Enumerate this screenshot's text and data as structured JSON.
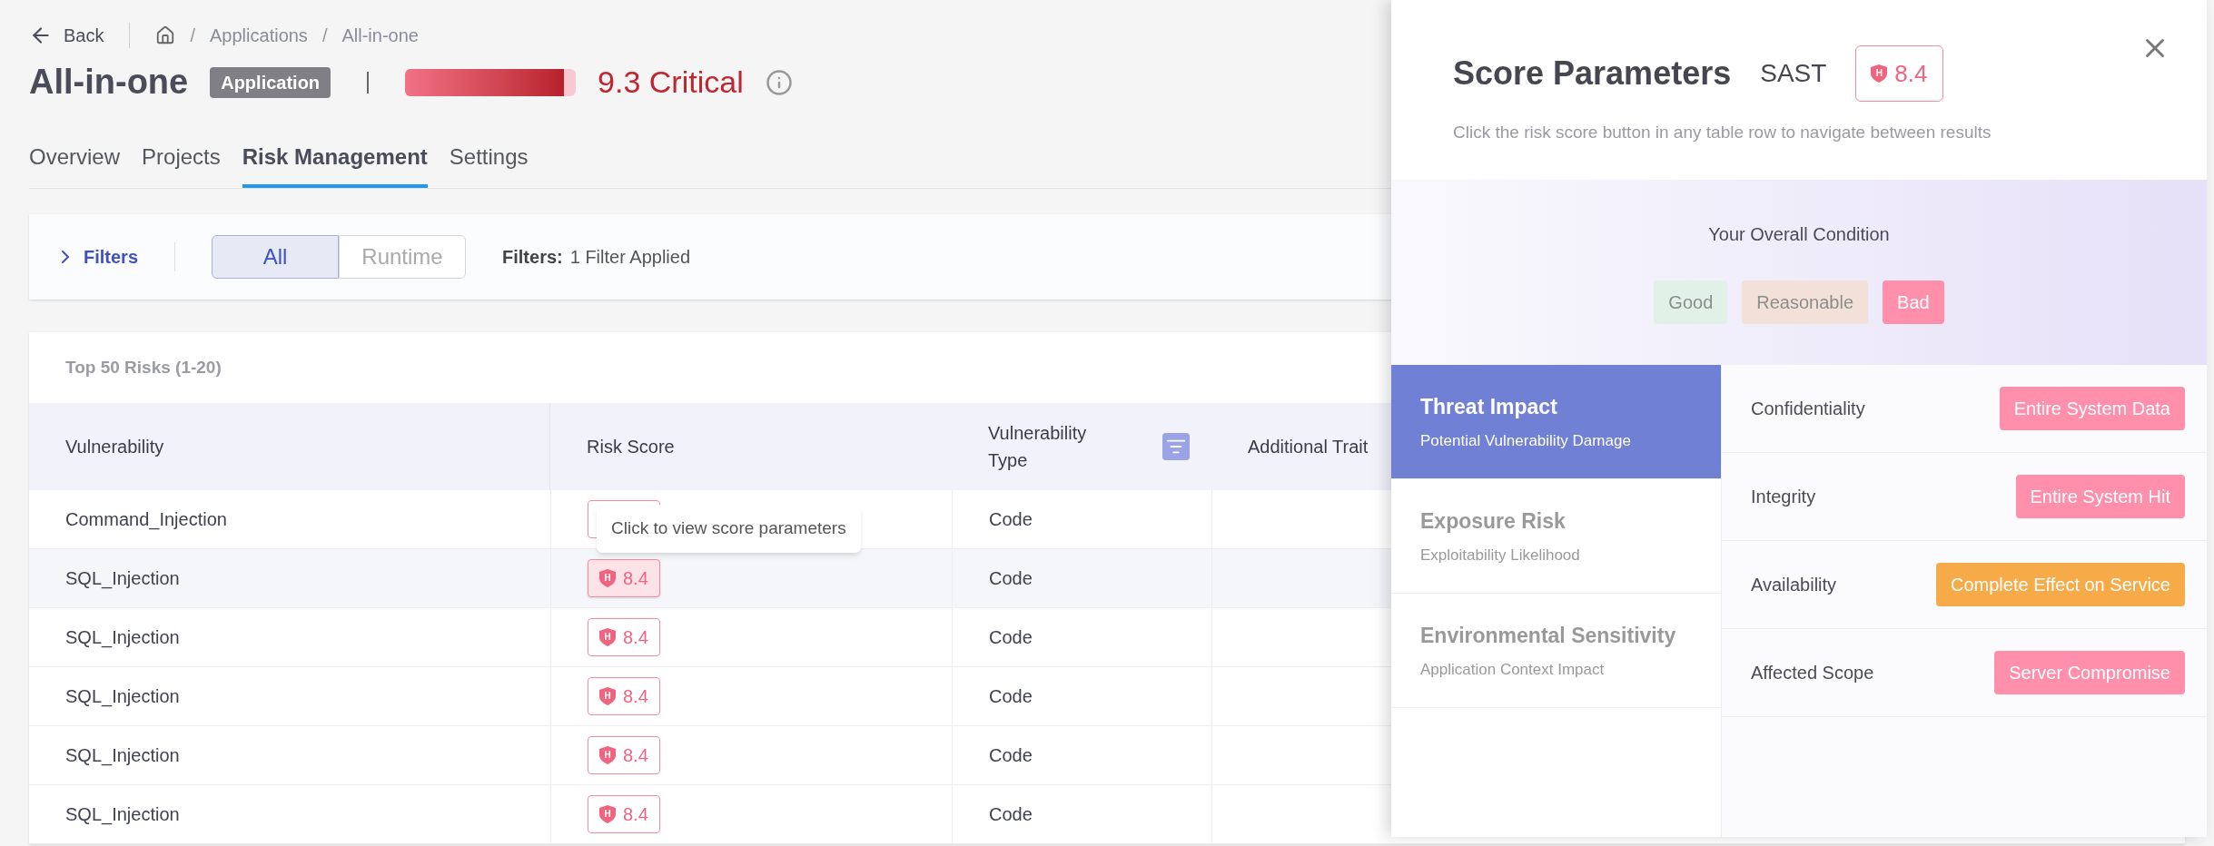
{
  "header": {
    "back": "Back",
    "breadcrumbs": [
      "Applications",
      "All-in-one"
    ],
    "separator": "/",
    "title": "All-in-one",
    "badge": "Application",
    "risk": {
      "level": 0.93,
      "reading": "9.3 Critical"
    }
  },
  "tabs": [
    {
      "label": "Overview",
      "selected": false
    },
    {
      "label": "Projects",
      "selected": false
    },
    {
      "label": "Risk Management",
      "selected": true
    },
    {
      "label": "Settings",
      "selected": false
    }
  ],
  "filters": {
    "toggle": "Filters",
    "segments": [
      {
        "label": "All",
        "selected": true
      },
      {
        "label": "Runtime",
        "selected": false
      }
    ],
    "summary_label": "Filters:",
    "summary": "1 Filter Applied"
  },
  "table": {
    "caption": "Top 50 Risks (1-20)",
    "columns": [
      "Vulnerability",
      "Risk Score",
      "Vulnerability Type",
      "Additional Trait"
    ],
    "rows": [
      {
        "vulnerability": "Command_Injection",
        "type": "Code",
        "highlighted": false,
        "tooltip": "Click to view score parameters"
      },
      {
        "vulnerability": "SQL_Injection",
        "severity": "H",
        "score": "8.4",
        "type": "Code",
        "highlighted": true
      },
      {
        "vulnerability": "SQL_Injection",
        "severity": "H",
        "score": "8.4",
        "type": "Code",
        "highlighted": false
      },
      {
        "vulnerability": "SQL_Injection",
        "severity": "H",
        "score": "8.4",
        "type": "Code",
        "highlighted": false
      },
      {
        "vulnerability": "SQL_Injection",
        "severity": "H",
        "score": "8.4",
        "type": "Code",
        "highlighted": false
      },
      {
        "vulnerability": "SQL_Injection",
        "severity": "H",
        "score": "8.4",
        "type": "Code",
        "highlighted": false
      }
    ]
  },
  "panel": {
    "title": "Score Parameters",
    "scanner": "SAST",
    "severity": "H",
    "score": "8.4",
    "subtitle": "Click the risk score button in any table row to navigate between results",
    "condition": {
      "label": "Your Overall Condition",
      "options": [
        {
          "label": "Good",
          "color": "#e2f1e7",
          "selected": false
        },
        {
          "label": "Reasonable",
          "color": "#f3e0d8",
          "selected": false
        },
        {
          "label": "Bad",
          "color": "#ff8fab",
          "selected": true
        }
      ]
    },
    "categories": [
      {
        "title": "Threat Impact",
        "subtitle": "Potential Vulnerability Damage",
        "selected": true
      },
      {
        "title": "Exposure Risk",
        "subtitle": "Exploitability Likelihood",
        "selected": false
      },
      {
        "title": "Environmental Sensitivity",
        "subtitle": "Application Context Impact",
        "selected": false
      }
    ],
    "parameters": [
      {
        "name": "Confidentiality",
        "value": "Entire System Data",
        "color": "#ff8fab"
      },
      {
        "name": "Integrity",
        "value": "Entire System Hit",
        "color": "#ff8fab"
      },
      {
        "name": "Availability",
        "value": "Complete Effect on Service",
        "color": "#f7ab48"
      },
      {
        "name": "Affected Scope",
        "value": "Server Compromise",
        "color": "#ff8fab"
      }
    ]
  }
}
